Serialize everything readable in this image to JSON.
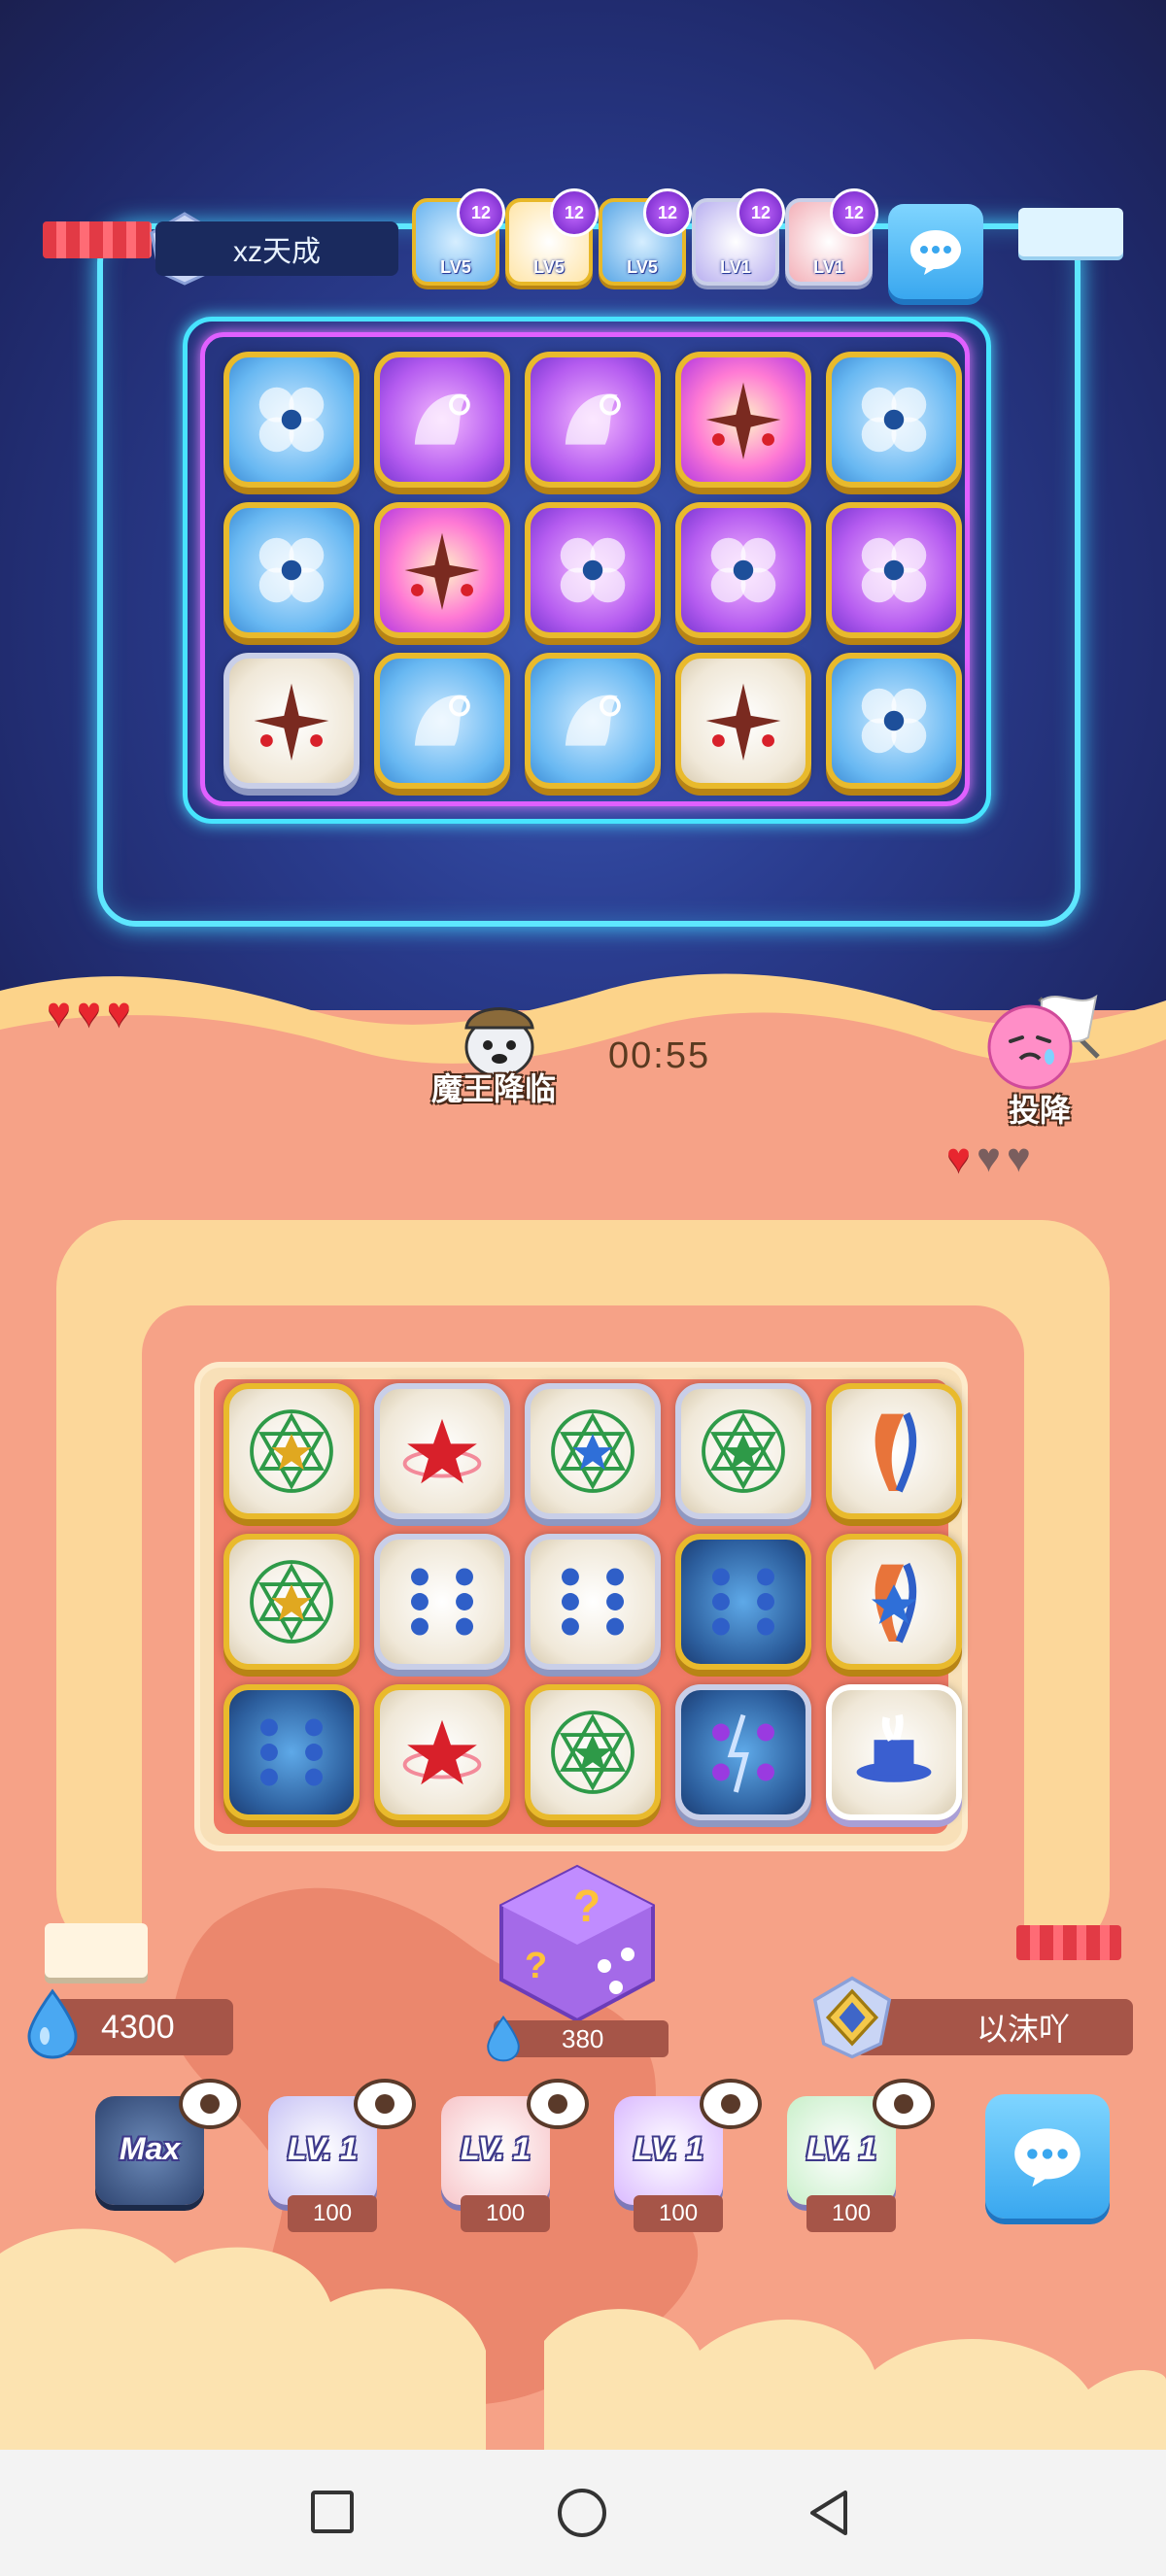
{
  "opponent": {
    "name": "xz天成",
    "rank_badge": "rank-II-badge",
    "deck": [
      {
        "level": "LV5",
        "badge": "12",
        "icon": "ice-die-icon"
      },
      {
        "level": "LV5",
        "badge": "12",
        "icon": "sun-die-icon"
      },
      {
        "level": "LV5",
        "badge": "12",
        "icon": "flower-die-icon"
      },
      {
        "level": "LV1",
        "badge": "12",
        "icon": "pegasus-die-icon"
      },
      {
        "level": "LV1",
        "badge": "12",
        "icon": "red-die-icon"
      }
    ],
    "hearts": [
      "full",
      "full",
      "full"
    ]
  },
  "battle": {
    "timer": "00:55",
    "boss_label": "魔王降临",
    "surrender_label": "投降"
  },
  "player": {
    "name": "以沫吖",
    "rank_badge": "rank-V-badge",
    "sp": "4300",
    "summon_cost": "380",
    "hearts": [
      "full",
      "empty",
      "empty"
    ],
    "deck": [
      {
        "level": "Max",
        "cost": "",
        "icon": "thunder-die-icon"
      },
      {
        "level": "LV. 1",
        "cost": "100",
        "icon": "flame-die-icon"
      },
      {
        "level": "LV. 1",
        "cost": "100",
        "icon": "red-star-die-icon"
      },
      {
        "level": "LV. 1",
        "cost": "100",
        "icon": "magic-hat-die-icon"
      },
      {
        "level": "LV. 1",
        "cost": "100",
        "icon": "hexagram-die-icon"
      }
    ]
  },
  "colors": {
    "top_bg": "#2a3c8e",
    "neon_cyan": "#5ee7ff",
    "neon_pink": "#e060ff",
    "bottom_bg": "#f6a287",
    "lane": "#fcd79a",
    "gold_border": "#e9ba2c"
  },
  "opponent_board": [
    [
      "blue-flower",
      "purple-pegasus",
      "purple-pegasus",
      "pink-sun",
      "blue-flower"
    ],
    [
      "blue-flower",
      "pink-sun",
      "purple-flower",
      "purple-flower",
      "purple-flower"
    ],
    [
      "white-sun",
      "blue-pegasus",
      "blue-pegasus",
      "white-sun",
      "blue-flower"
    ]
  ],
  "player_board": [
    [
      "hexagram-star",
      "red-star",
      "hexagram-blue",
      "hexagram-dots",
      "flame-figure"
    ],
    [
      "hexagram-star",
      "dots-figure",
      "dots-figure",
      "thunder-dots",
      "flame-star"
    ],
    [
      "thunder-dots",
      "red-star",
      "hexagram-gold",
      "thunder-purple",
      "magic-hat"
    ]
  ]
}
